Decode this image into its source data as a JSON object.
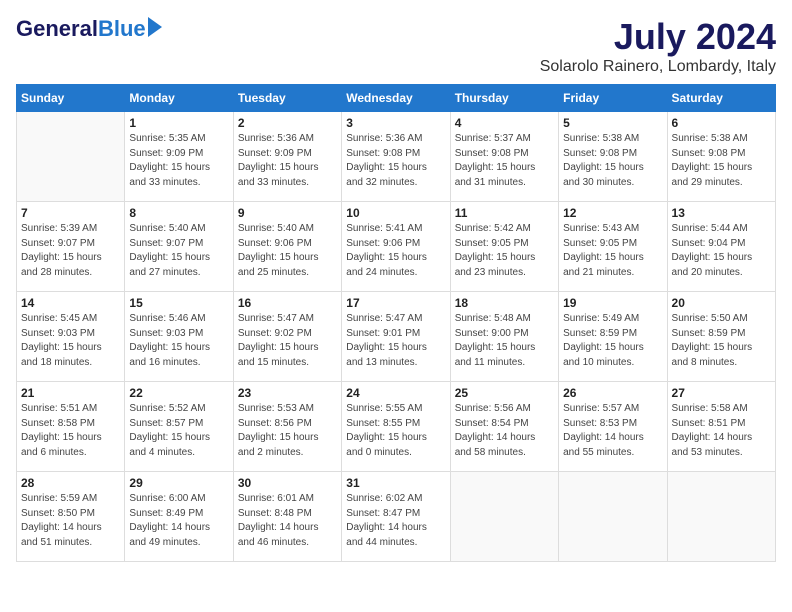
{
  "header": {
    "logo_general": "General",
    "logo_blue": "Blue",
    "title": "July 2024",
    "subtitle": "Solarolo Rainero, Lombardy, Italy"
  },
  "days_of_week": [
    "Sunday",
    "Monday",
    "Tuesday",
    "Wednesday",
    "Thursday",
    "Friday",
    "Saturday"
  ],
  "weeks": [
    [
      {
        "day": "",
        "info": ""
      },
      {
        "day": "1",
        "info": "Sunrise: 5:35 AM\nSunset: 9:09 PM\nDaylight: 15 hours\nand 33 minutes."
      },
      {
        "day": "2",
        "info": "Sunrise: 5:36 AM\nSunset: 9:09 PM\nDaylight: 15 hours\nand 33 minutes."
      },
      {
        "day": "3",
        "info": "Sunrise: 5:36 AM\nSunset: 9:08 PM\nDaylight: 15 hours\nand 32 minutes."
      },
      {
        "day": "4",
        "info": "Sunrise: 5:37 AM\nSunset: 9:08 PM\nDaylight: 15 hours\nand 31 minutes."
      },
      {
        "day": "5",
        "info": "Sunrise: 5:38 AM\nSunset: 9:08 PM\nDaylight: 15 hours\nand 30 minutes."
      },
      {
        "day": "6",
        "info": "Sunrise: 5:38 AM\nSunset: 9:08 PM\nDaylight: 15 hours\nand 29 minutes."
      }
    ],
    [
      {
        "day": "7",
        "info": "Sunrise: 5:39 AM\nSunset: 9:07 PM\nDaylight: 15 hours\nand 28 minutes."
      },
      {
        "day": "8",
        "info": "Sunrise: 5:40 AM\nSunset: 9:07 PM\nDaylight: 15 hours\nand 27 minutes."
      },
      {
        "day": "9",
        "info": "Sunrise: 5:40 AM\nSunset: 9:06 PM\nDaylight: 15 hours\nand 25 minutes."
      },
      {
        "day": "10",
        "info": "Sunrise: 5:41 AM\nSunset: 9:06 PM\nDaylight: 15 hours\nand 24 minutes."
      },
      {
        "day": "11",
        "info": "Sunrise: 5:42 AM\nSunset: 9:05 PM\nDaylight: 15 hours\nand 23 minutes."
      },
      {
        "day": "12",
        "info": "Sunrise: 5:43 AM\nSunset: 9:05 PM\nDaylight: 15 hours\nand 21 minutes."
      },
      {
        "day": "13",
        "info": "Sunrise: 5:44 AM\nSunset: 9:04 PM\nDaylight: 15 hours\nand 20 minutes."
      }
    ],
    [
      {
        "day": "14",
        "info": "Sunrise: 5:45 AM\nSunset: 9:03 PM\nDaylight: 15 hours\nand 18 minutes."
      },
      {
        "day": "15",
        "info": "Sunrise: 5:46 AM\nSunset: 9:03 PM\nDaylight: 15 hours\nand 16 minutes."
      },
      {
        "day": "16",
        "info": "Sunrise: 5:47 AM\nSunset: 9:02 PM\nDaylight: 15 hours\nand 15 minutes."
      },
      {
        "day": "17",
        "info": "Sunrise: 5:47 AM\nSunset: 9:01 PM\nDaylight: 15 hours\nand 13 minutes."
      },
      {
        "day": "18",
        "info": "Sunrise: 5:48 AM\nSunset: 9:00 PM\nDaylight: 15 hours\nand 11 minutes."
      },
      {
        "day": "19",
        "info": "Sunrise: 5:49 AM\nSunset: 8:59 PM\nDaylight: 15 hours\nand 10 minutes."
      },
      {
        "day": "20",
        "info": "Sunrise: 5:50 AM\nSunset: 8:59 PM\nDaylight: 15 hours\nand 8 minutes."
      }
    ],
    [
      {
        "day": "21",
        "info": "Sunrise: 5:51 AM\nSunset: 8:58 PM\nDaylight: 15 hours\nand 6 minutes."
      },
      {
        "day": "22",
        "info": "Sunrise: 5:52 AM\nSunset: 8:57 PM\nDaylight: 15 hours\nand 4 minutes."
      },
      {
        "day": "23",
        "info": "Sunrise: 5:53 AM\nSunset: 8:56 PM\nDaylight: 15 hours\nand 2 minutes."
      },
      {
        "day": "24",
        "info": "Sunrise: 5:55 AM\nSunset: 8:55 PM\nDaylight: 15 hours\nand 0 minutes."
      },
      {
        "day": "25",
        "info": "Sunrise: 5:56 AM\nSunset: 8:54 PM\nDaylight: 14 hours\nand 58 minutes."
      },
      {
        "day": "26",
        "info": "Sunrise: 5:57 AM\nSunset: 8:53 PM\nDaylight: 14 hours\nand 55 minutes."
      },
      {
        "day": "27",
        "info": "Sunrise: 5:58 AM\nSunset: 8:51 PM\nDaylight: 14 hours\nand 53 minutes."
      }
    ],
    [
      {
        "day": "28",
        "info": "Sunrise: 5:59 AM\nSunset: 8:50 PM\nDaylight: 14 hours\nand 51 minutes."
      },
      {
        "day": "29",
        "info": "Sunrise: 6:00 AM\nSunset: 8:49 PM\nDaylight: 14 hours\nand 49 minutes."
      },
      {
        "day": "30",
        "info": "Sunrise: 6:01 AM\nSunset: 8:48 PM\nDaylight: 14 hours\nand 46 minutes."
      },
      {
        "day": "31",
        "info": "Sunrise: 6:02 AM\nSunset: 8:47 PM\nDaylight: 14 hours\nand 44 minutes."
      },
      {
        "day": "",
        "info": ""
      },
      {
        "day": "",
        "info": ""
      },
      {
        "day": "",
        "info": ""
      }
    ]
  ]
}
